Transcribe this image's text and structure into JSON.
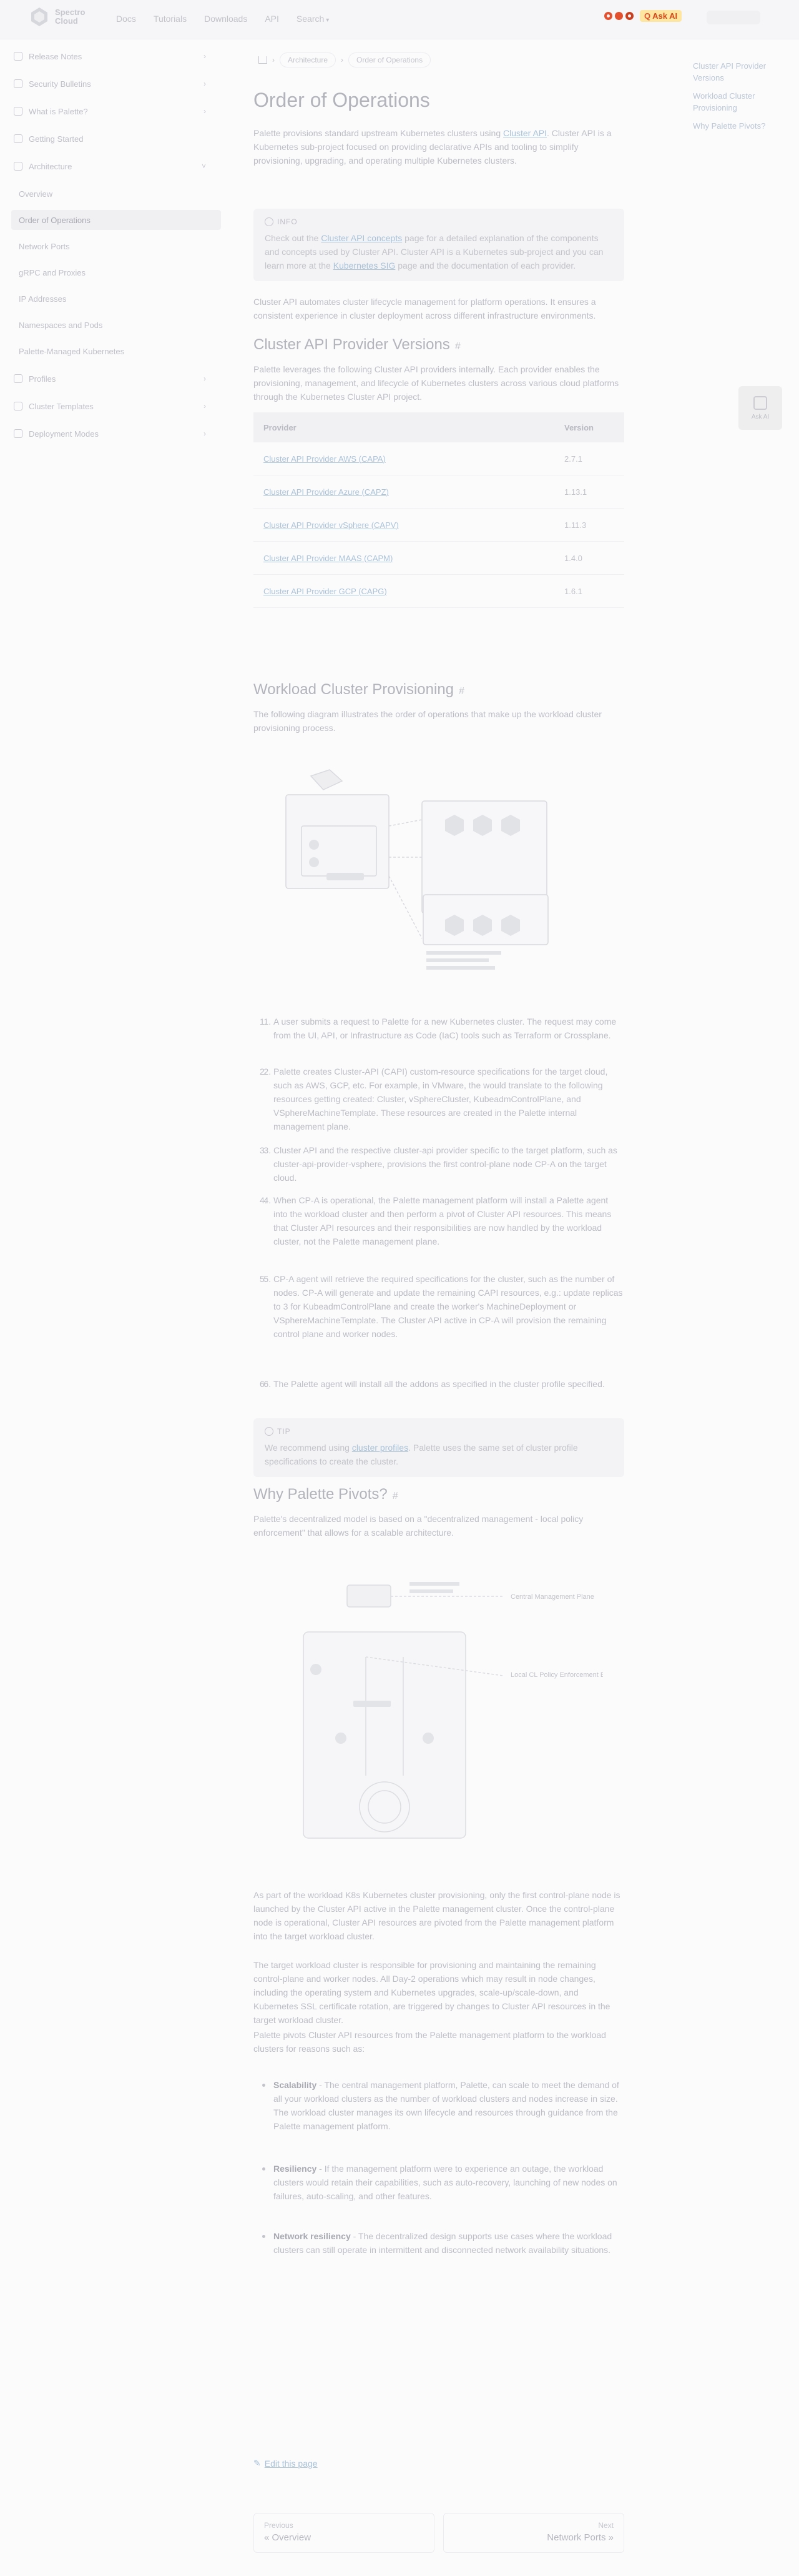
{
  "header": {
    "logo_text": "Spectro\nCloud",
    "nav": [
      "Docs",
      "Tutorials",
      "Downloads",
      "API",
      "Search"
    ],
    "ask_label": "Ask AI",
    "ask_prefix": "Q"
  },
  "sidebar": {
    "items": [
      {
        "label": "Release Notes",
        "has_children": true
      },
      {
        "label": "Security Bulletins",
        "has_children": true
      },
      {
        "label": "What is Palette?",
        "has_children": true
      },
      {
        "label": "Getting Started",
        "has_children": false
      },
      {
        "label": "Architecture",
        "has_children": true,
        "expanded": true
      }
    ],
    "sub_items": [
      "Overview",
      "Order of Operations",
      "Network Ports",
      "gRPC and Proxies",
      "IP Addresses",
      "Namespaces and Pods",
      "Palette-Managed Kubernetes"
    ],
    "active_sub": "Order of Operations",
    "after_items": [
      {
        "label": "Profiles",
        "has_children": true
      },
      {
        "label": "Cluster Templates",
        "has_children": true
      },
      {
        "label": "Deployment Modes",
        "has_children": true
      }
    ]
  },
  "breadcrumbs": [
    "Architecture",
    "Order of Operations"
  ],
  "page_title": "Order of Operations",
  "intro": {
    "pre": "Palette provisions standard upstream Kubernetes clusters using ",
    "link": "Cluster API",
    "post": ". Cluster API is a Kubernetes sub-project focused on providing declarative APIs and tooling to simplify provisioning, upgrading, and operating multiple Kubernetes clusters."
  },
  "info_box": {
    "label": "INFO",
    "pre": "Check out the ",
    "link1": "Cluster API concepts",
    "mid": " page for a detailed explanation of the components and concepts used by Cluster API. Cluster API is a Kubernetes sub-project and you can learn more at the ",
    "link2": "Kubernetes SIG",
    "post": " page and the documentation of each provider."
  },
  "cluster_api_text": "Cluster API automates cluster lifecycle management for platform operations. It ensures a consistent experience in cluster deployment across different infrastructure environments.",
  "provider_section": {
    "heading": "Cluster API Provider Versions",
    "hash": "#",
    "text": "Palette leverages the following Cluster API providers internally. Each provider enables the provisioning, management, and lifecycle of Kubernetes clusters across various cloud platforms through the Kubernetes Cluster API project.",
    "table": {
      "headers": [
        "Provider",
        "Version"
      ],
      "rows": [
        [
          "Cluster API Provider AWS (CAPA)",
          "2.7.1"
        ],
        [
          "Cluster API Provider Azure (CAPZ)",
          "1.13.1"
        ],
        [
          "Cluster API Provider vSphere (CAPV)",
          "1.11.3"
        ],
        [
          "Cluster API Provider MAAS (CAPM)",
          "1.4.0"
        ],
        [
          "Cluster API Provider GCP (CAPG)",
          "1.6.1"
        ]
      ]
    }
  },
  "provisioning_section": {
    "heading": "Workload Cluster Provisioning",
    "hash": "#",
    "text": "The following diagram illustrates the order of operations that make up the workload cluster provisioning process."
  },
  "steps": [
    "A user submits a request to Palette for a new Kubernetes cluster. The request may come from the UI, API, or Infrastructure as Code (IaC) tools such as Terraform or Crossplane.",
    "Palette creates Cluster-API (CAPI) custom-resource specifications for the target cloud, such as AWS, GCP, etc. For example, in VMware, the would translate to the following resources getting created: Cluster, vSphereCluster, KubeadmControlPlane, and VSphereMachineTemplate. These resources are created in the Palette internal management plane.",
    "Cluster API and the respective cluster-api provider specific to the target platform, such as cluster-api-provider-vsphere, provisions the first control-plane node CP-A on the target cloud.",
    "When CP-A is operational, the Palette management platform will install a Palette agent into the workload cluster and then perform a pivot of Cluster API resources. This means that Cluster API resources and their responsibilities are now handled by the workload cluster, not the Palette management plane.",
    "CP-A agent will retrieve the required specifications for the cluster, such as the number of nodes. CP-A will generate and update the remaining CAPI resources, e.g.: update replicas to 3 for KubeadmControlPlane and create the worker's MachineDeployment or VSphereMachineTemplate. The Cluster API active in CP-A will provision the remaining control plane and worker nodes.",
    "The Palette agent will install all the addons as specified in the cluster profile specified."
  ],
  "tip_box": {
    "label": "TIP",
    "pre": "We recommend using ",
    "link": "cluster profiles",
    "post": ". Palette uses the same set of cluster profile specifications to create the cluster."
  },
  "pivot_section": {
    "heading": "Why Palette Pivots?",
    "hash": "#",
    "text": "Palette's decentralized model is based on a \"decentralized management - local policy enforcement\" that allows for a scalable architecture."
  },
  "diagram2_labels": {
    "top_right": "Central Management Plane",
    "mid_right": "Local CL Policy\nEnforcement Engine"
  },
  "pivot_paras": [
    "As part of the workload K8s Kubernetes cluster provisioning, only the first control-plane node is launched by the Cluster API active in the Palette management cluster. Once the control-plane node is operational, Cluster API resources are pivoted from the Palette management platform into the target workload cluster.",
    "The target workload cluster is responsible for provisioning and maintaining the remaining control-plane and worker nodes. All Day-2 operations which may result in node changes, including the operating system and Kubernetes upgrades, scale-up/scale-down, and Kubernetes SSL certificate rotation, are triggered by changes to Cluster API resources in the target workload cluster.",
    "Palette pivots Cluster API resources from the Palette management platform to the workload clusters for reasons such as:"
  ],
  "reasons": [
    {
      "title": "Scalability",
      "text": " - The central management platform, Palette, can scale to meet the demand of all your workload clusters as the number of workload clusters and nodes increase in size. The workload cluster manages its own lifecycle and resources through guidance from the Palette management platform."
    },
    {
      "title": "Resiliency",
      "text": " - If the management platform were to experience an outage, the workload clusters would retain their capabilities, such as auto-recovery, launching of new nodes on failures, auto-scaling, and other features."
    },
    {
      "title": "Network resiliency",
      "text": " - The decentralized design supports use cases where the workload clusters can still operate in intermittent and disconnected network availability situations."
    }
  ],
  "edit_link": "Edit this page",
  "pager": {
    "prev_label": "Previous",
    "prev_title": "« Overview",
    "next_label": "Next",
    "next_title": "Network Ports »"
  },
  "toc": [
    "Cluster API Provider Versions",
    "Workload Cluster Provisioning",
    "Why Palette Pivots?"
  ],
  "float_button_label": "Ask AI"
}
